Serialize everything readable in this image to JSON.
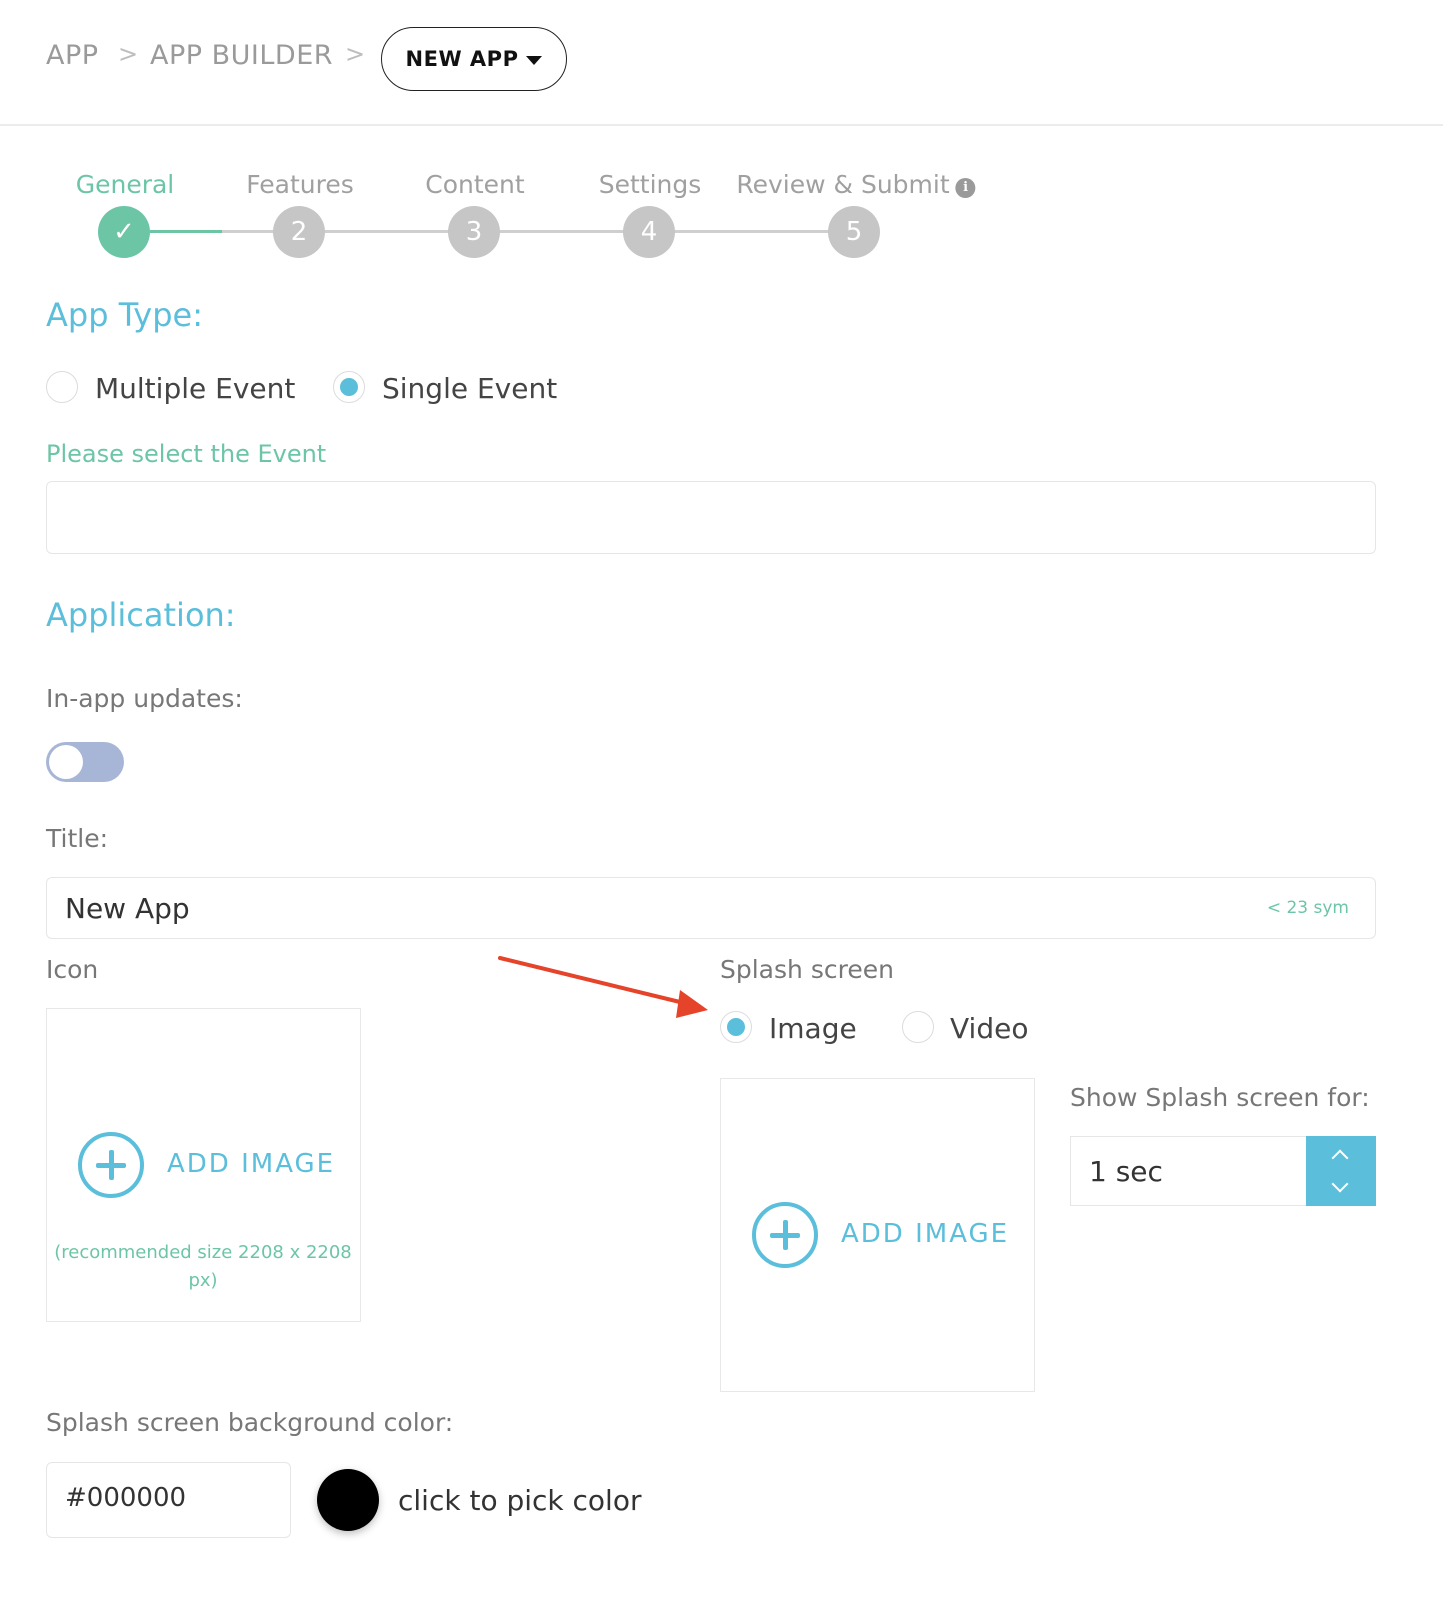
{
  "breadcrumb": {
    "items": [
      "APP",
      "APP BUILDER"
    ],
    "separator": ">",
    "current": "NEW APP"
  },
  "stepper": {
    "steps": [
      {
        "label": "General",
        "number": "",
        "state": "done"
      },
      {
        "label": "Features",
        "number": "2",
        "state": "pending"
      },
      {
        "label": "Content",
        "number": "3",
        "state": "pending"
      },
      {
        "label": "Settings",
        "number": "4",
        "state": "pending"
      },
      {
        "label": "Review & Submit",
        "number": "5",
        "state": "pending"
      }
    ],
    "check_glyph": "✓",
    "info_glyph": "i"
  },
  "app_type": {
    "title": "App Type:",
    "options": [
      {
        "label": "Multiple Event",
        "selected": false
      },
      {
        "label": "Single Event",
        "selected": true
      }
    ],
    "event_label": "Please select the Event",
    "event_value": ""
  },
  "application": {
    "title": "Application:",
    "in_app_updates_label": "In-app updates:",
    "in_app_updates_on": false,
    "title_label": "Title:",
    "title_value": "New App",
    "title_hint": "< 23 sym",
    "icon_label": "Icon",
    "add_image_label": "ADD IMAGE",
    "icon_recommendation": "(recommended size 2208 x 2208 px)",
    "splash_label": "Splash screen",
    "splash_options": [
      {
        "label": "Image",
        "selected": true
      },
      {
        "label": "Video",
        "selected": false
      }
    ],
    "splash_add_image_label": "ADD IMAGE",
    "show_splash_label": "Show Splash screen for:",
    "show_splash_value": "1 sec",
    "bg_color_label": "Splash screen background color:",
    "bg_color_value": "#000000",
    "pick_color_label": "click to pick color"
  },
  "colors": {
    "accent_blue": "#5bbedb",
    "accent_green": "#6cc6a6",
    "annotation_arrow": "#e5432a"
  }
}
